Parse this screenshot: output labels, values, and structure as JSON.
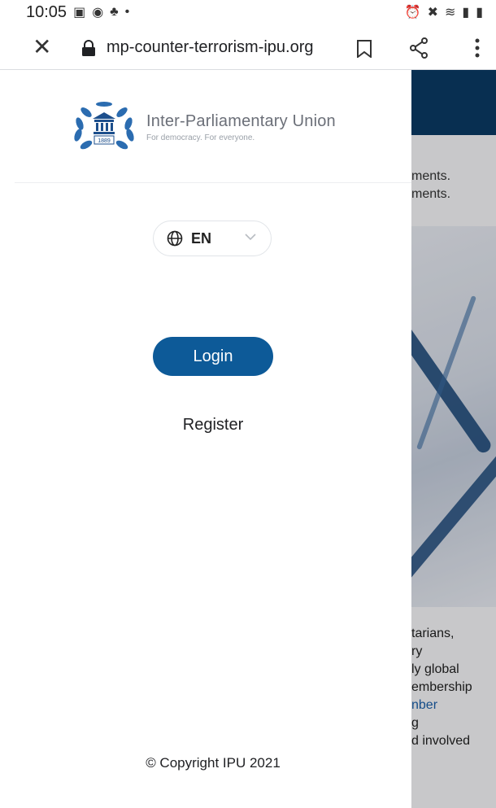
{
  "status_bar": {
    "time": "10:05",
    "icons": [
      "gallery-icon",
      "messenger-icon",
      "person-icon",
      "dot-icon",
      "alarm-icon",
      "wifi-icon",
      "signal-icon",
      "battery-icon"
    ]
  },
  "browser": {
    "url": "mp-counter-terrorism-ipu.org"
  },
  "drawer": {
    "logo": {
      "title": "Inter-Parliamentary Union",
      "subtitle": "For democracy. For everyone.",
      "year": "1889"
    },
    "language": {
      "code": "EN"
    },
    "login_label": "Login",
    "register_label": "Register",
    "copyright": "© Copyright IPU 2021"
  },
  "background_page": {
    "intro_lines": [
      "ments.",
      "ments."
    ],
    "body_lines": [
      "tarians,",
      "ry",
      "ly global",
      "embership",
      "nber",
      "g",
      "d involved"
    ]
  },
  "colors": {
    "primary": "#0d5a98",
    "header_dark": "#0a3a63",
    "link": "#1a5fa8"
  }
}
